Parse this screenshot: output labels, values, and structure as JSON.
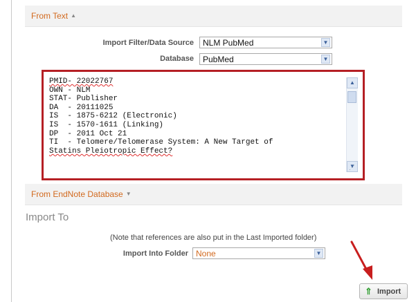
{
  "from_text": {
    "title": "From Text",
    "caret": "▲",
    "import_filter_label": "Import Filter/Data Source",
    "import_filter_value": "NLM PubMed",
    "database_label": "Database",
    "database_value": "PubMed"
  },
  "textarea": {
    "lines": [
      "PMID- 22022767",
      "OWN - NLM",
      "STAT- Publisher",
      "DA  - 20111025",
      "IS  - 1875-6212 (Electronic)",
      "IS  - 1570-1611 (Linking)",
      "DP  - 2011 Oct 21",
      "TI  - Telomere/Telomerase System: A New Target of",
      "Statins Pleiotropic Effect?"
    ],
    "highlight_color": "#b51f24"
  },
  "from_endnote": {
    "title": "From EndNote Database",
    "caret": "▼"
  },
  "import_to": {
    "heading": "Import To",
    "note": "(Note that references are also put in the Last Imported folder)",
    "folder_label": "Import Into Folder",
    "folder_value": "None"
  },
  "import_button": {
    "label": "Import",
    "icon": "up-arrow-icon"
  },
  "colors": {
    "accent": "#d2691e",
    "annotation": "#c81e1e"
  }
}
